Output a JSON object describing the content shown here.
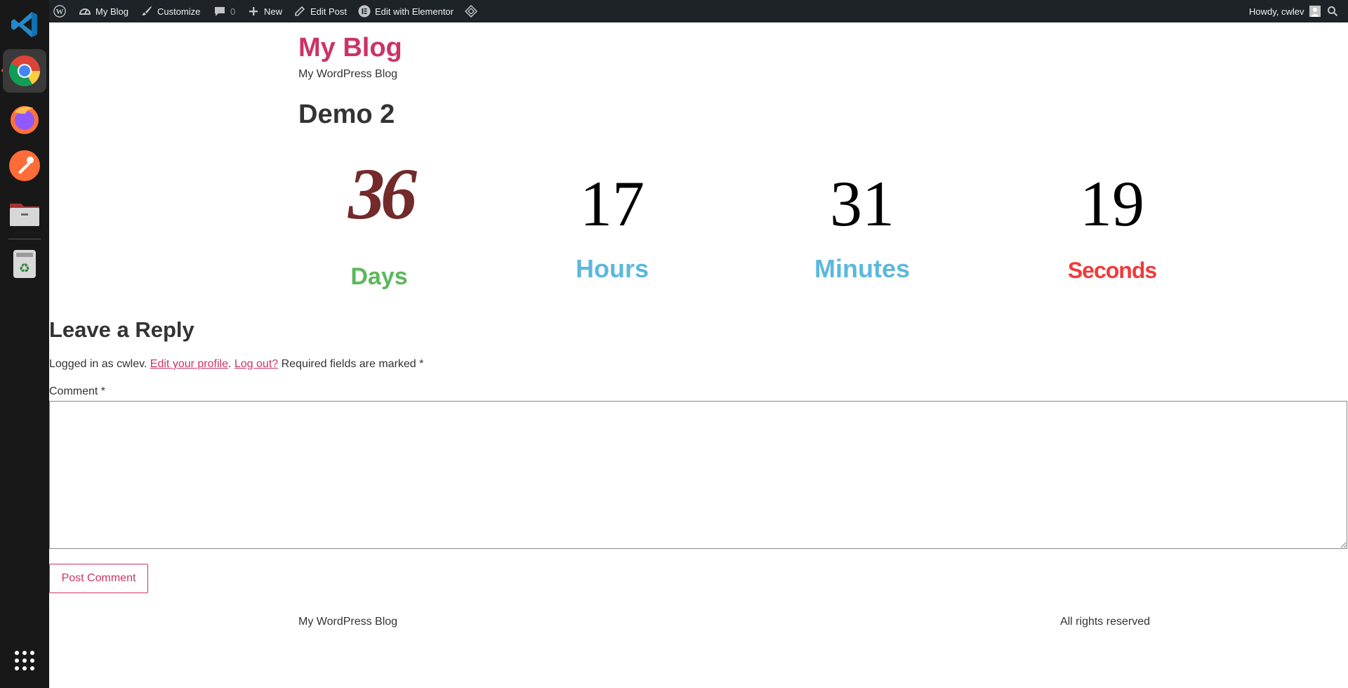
{
  "adminbar": {
    "site_name": "My Blog",
    "customize": "Customize",
    "comments_count": "0",
    "new": "New",
    "edit_post": "Edit Post",
    "edit_elementor": "Edit with Elementor",
    "howdy": "Howdy, cwlev"
  },
  "site": {
    "title": "My Blog",
    "description": "My WordPress Blog"
  },
  "post": {
    "title": "Demo 2"
  },
  "countdown": {
    "days": "36",
    "hours": "17",
    "minutes": "31",
    "seconds": "19",
    "days_label": "Days",
    "hours_label": "Hours",
    "minutes_label": "Minutes",
    "seconds_label": "Seconds",
    "colors": {
      "days_num": "#722a2a",
      "days_label": "#5cb85c",
      "hours_label": "#5bb8dc",
      "minutes_label": "#5bb8dc",
      "seconds_label": "#ef3b3b"
    }
  },
  "reply": {
    "title": "Leave a Reply",
    "logged_in_prefix": "Logged in as cwlev.",
    "edit_profile": "Edit your profile",
    "separator": ".",
    "logout": "Log out?",
    "required": "Required fields are marked *",
    "comment_label": "Comment *",
    "comment_value": "",
    "submit": "Post Comment"
  },
  "footer": {
    "left": "My WordPress Blog",
    "right": "All rights reserved"
  },
  "dock": {
    "icons": [
      "vscode-icon",
      "chrome-icon",
      "firefox-icon",
      "postman-icon",
      "files-icon",
      "trash-icon",
      "app-grid-icon"
    ]
  }
}
